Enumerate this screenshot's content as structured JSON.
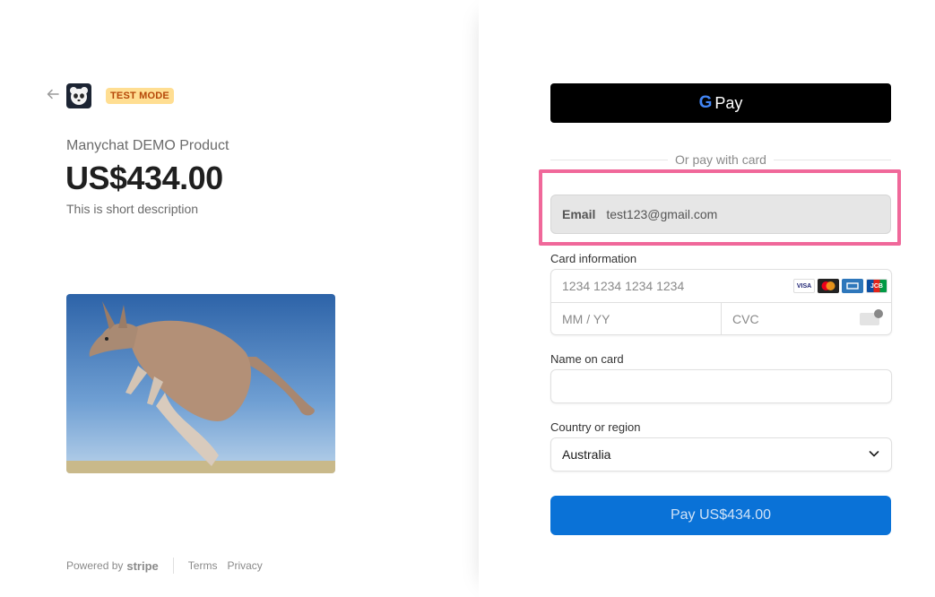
{
  "header": {
    "back_icon": "arrow-left-icon",
    "logo_icon": "panda-logo-icon",
    "test_mode_badge": "TEST MODE"
  },
  "product": {
    "name": "Manychat DEMO Product",
    "price": "US$434.00",
    "description": "This is short description",
    "image_subject": "kangaroo"
  },
  "footer": {
    "powered_by": "Powered by",
    "brand": "stripe",
    "terms": "Terms",
    "privacy": "Privacy"
  },
  "payment": {
    "gpay_g": "G",
    "gpay_label": "Pay",
    "divider_text": "Or pay with card",
    "email_label": "Email",
    "email_value": "test123@gmail.com",
    "card_info_label": "Card information",
    "card_number_placeholder": "1234 1234 1234 1234",
    "expiry_placeholder": "MM / YY",
    "cvc_placeholder": "CVC",
    "card_brands": [
      "VISA",
      "MC",
      "AMEX",
      "JCB"
    ],
    "name_label": "Name on card",
    "name_value": "",
    "country_label": "Country or region",
    "country_value": "Australia",
    "pay_button": "Pay US$434.00"
  },
  "colors": {
    "pay_button": "#0a72d7",
    "highlight": "#f0689a",
    "badge_bg": "#ffde92",
    "badge_text": "#b54708"
  }
}
